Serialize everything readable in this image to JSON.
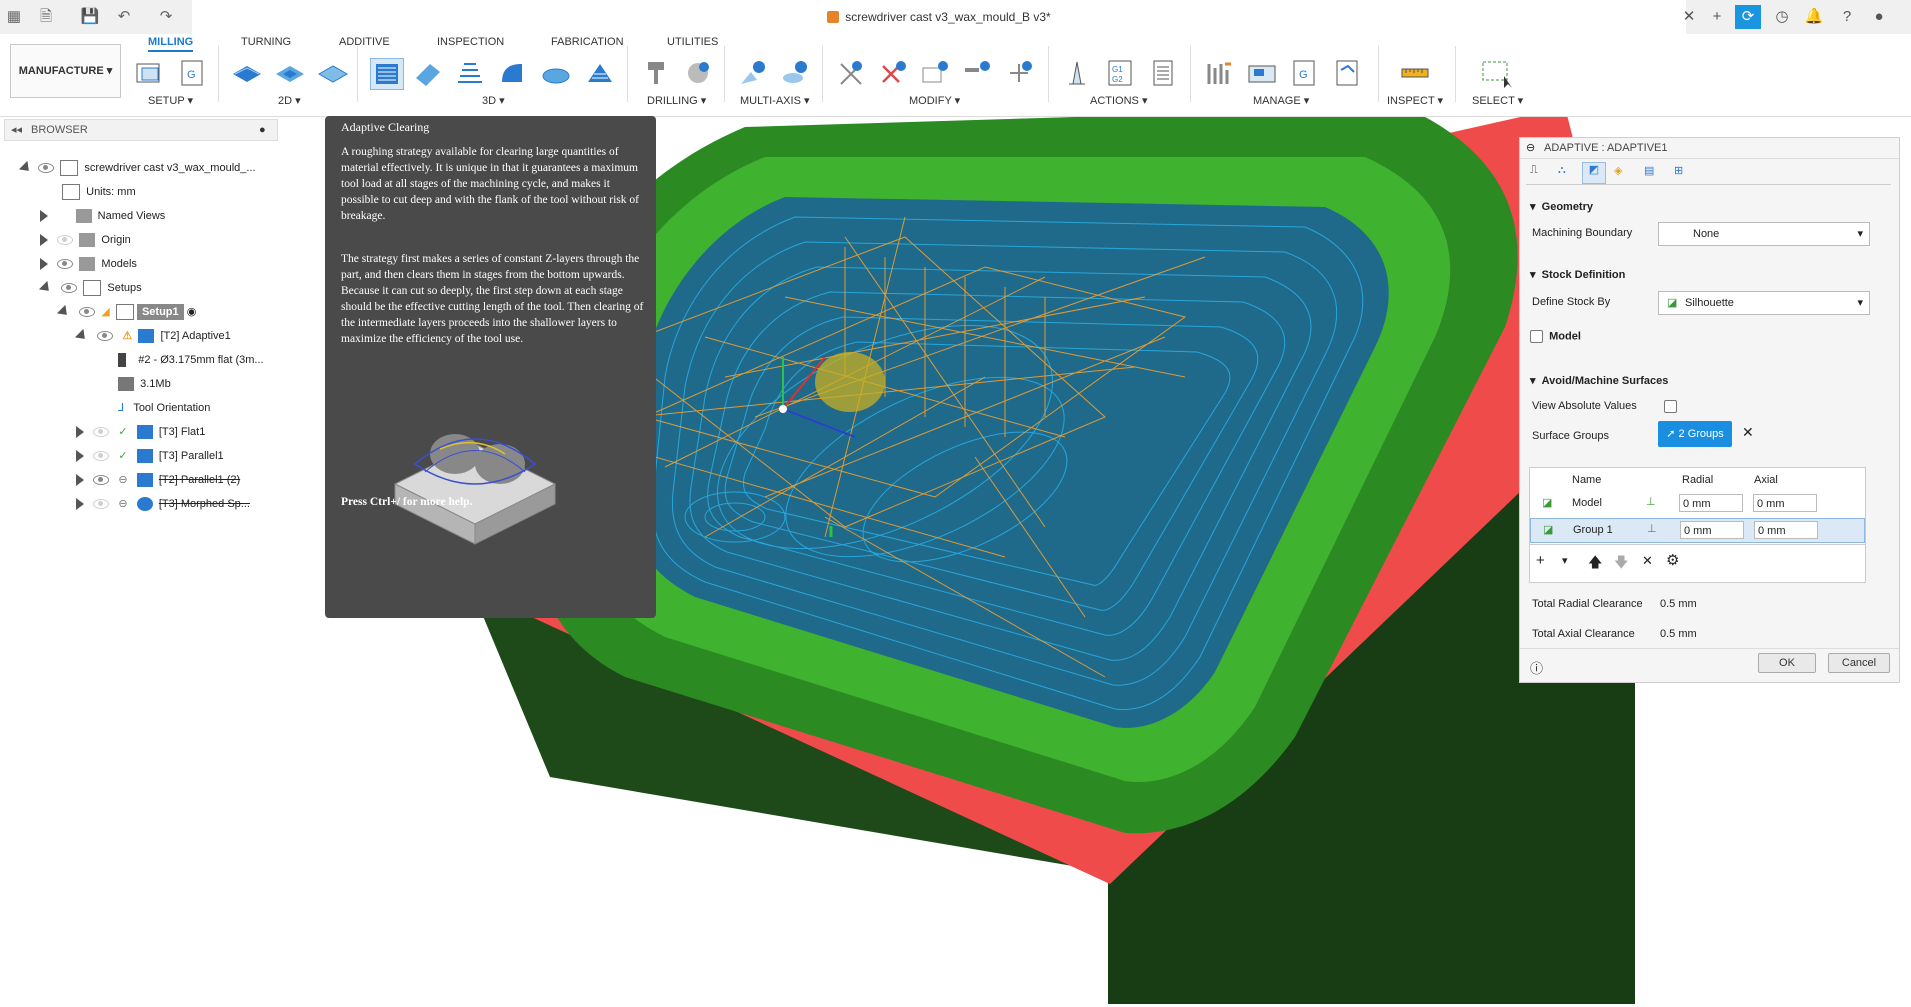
{
  "window": {
    "title": "screwdriver cast v3_wax_mould_B v3*"
  },
  "ribbon": {
    "workspace": "MANUFACTURE",
    "tabs": [
      "MILLING",
      "TURNING",
      "ADDITIVE",
      "INSPECTION",
      "FABRICATION",
      "UTILITIES"
    ],
    "groups": [
      "SETUP",
      "2D",
      "3D",
      "DRILLING",
      "MULTI-AXIS",
      "MODIFY",
      "ACTIONS",
      "MANAGE",
      "INSPECT",
      "SELECT"
    ]
  },
  "browser": {
    "title": "BROWSER",
    "items": [
      {
        "label": "screwdriver cast v3_wax_mould_..."
      },
      {
        "label": "Units: mm"
      },
      {
        "label": "Named Views"
      },
      {
        "label": "Origin"
      },
      {
        "label": "Models"
      },
      {
        "label": "Setups"
      },
      {
        "label": "Setup1"
      },
      {
        "label": "[T2] Adaptive1"
      },
      {
        "label": "#2 - Ø3.175mm flat (3m..."
      },
      {
        "label": "3.1Mb"
      },
      {
        "label": "Tool Orientation"
      },
      {
        "label": "[T3] Flat1"
      },
      {
        "label": "[T3] Parallel1"
      },
      {
        "label": "[T2] Parallel1 (2)"
      },
      {
        "label": "[T3] Morphed Sp..."
      }
    ]
  },
  "tooltip": {
    "title": "Adaptive Clearing",
    "para1": "A roughing strategy available for clearing large quantities of material effectively. It is unique in that it guarantees a maximum tool load at all stages of the machining cycle, and makes it possible to cut deep and with the flank of the tool without risk of breakage.",
    "para2": "The strategy first makes a series of constant Z-layers through the part, and then clears them in stages from the bottom upwards. Because it can cut so deeply, the first step down at each stage should be the effective cutting length of the tool. Then clearing of the intermediate layers proceeds into the shallower layers to maximize the efficiency of the tool use.",
    "footer": "Press Ctrl+/ for more help."
  },
  "panel": {
    "title": "ADAPTIVE : ADAPTIVE1",
    "geometry": {
      "heading": "Geometry",
      "machining_boundary_label": "Machining Boundary",
      "machining_boundary_value": "None"
    },
    "stock": {
      "heading": "Stock Definition",
      "define_stock_label": "Define Stock By",
      "define_stock_value": "Silhouette"
    },
    "model_label": "Model",
    "avoid": {
      "heading": "Avoid/Machine Surfaces",
      "view_absolute_label": "View Absolute Values",
      "surface_groups_label": "Surface Groups",
      "surface_groups_value": "2 Groups",
      "columns": [
        "Name",
        "Radial",
        "Axial"
      ],
      "rows": [
        {
          "name": "Model",
          "radial": "0 mm",
          "axial": "0 mm"
        },
        {
          "name": "Group 1",
          "radial": "0 mm",
          "axial": "0 mm"
        }
      ]
    },
    "total_radial_label": "Total Radial Clearance",
    "total_radial_value": "0.5 mm",
    "total_axial_label": "Total Axial Clearance",
    "total_axial_value": "0.5 mm",
    "ok_label": "OK",
    "cancel_label": "Cancel"
  },
  "colors": {
    "accent": "#1a7bd0",
    "stock_red": "#f04b4b",
    "part_green": "#1e4a1a",
    "toolpath_orange": "#f0a030",
    "toolpath_blue": "#2a9ad8"
  }
}
